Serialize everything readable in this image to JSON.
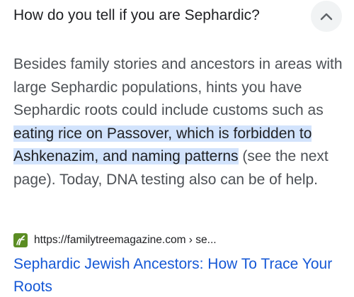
{
  "question": {
    "text": "How do you tell if you are Sephardic?",
    "expanded": true,
    "toggle_icon": "chevron-up-icon"
  },
  "answer": {
    "before": "Besides family stories and ancestors in areas with large Sephardic populations, hints you have Sephardic roots could include customs such as ",
    "highlight": "eating rice on Passover, which is forbidden to Ashkenazim, and naming patterns",
    "after": " (see the next page). Today, DNA testing also can be of help."
  },
  "source": {
    "favicon_icon": "familytreemagazine-favicon-icon",
    "favicon_color": "#5b8d23",
    "url": "https://familytreemagazine.com › se..."
  },
  "result": {
    "title": "Sephardic Jewish Ancestors: How To Trace Your Roots",
    "link_color": "#1558d6"
  },
  "colors": {
    "highlight_bg": "#d2e3fc",
    "body_text": "#4d5156",
    "heading_text": "#202124"
  }
}
